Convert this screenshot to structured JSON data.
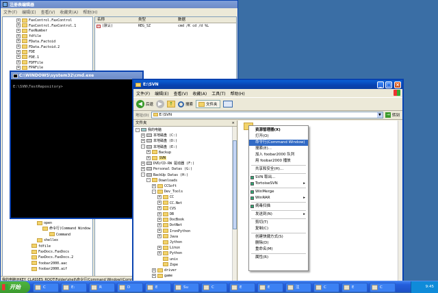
{
  "regedit": {
    "title": "注册表编辑器",
    "menu": [
      "文件(F)",
      "编辑(E)",
      "查看(V)",
      "收藏夹(A)",
      "帮助(H)"
    ],
    "tree_items": [
      "FaxControl.FaxControl",
      "FaxControl.FaxControl.1",
      "FaxNumber",
      "fdfile",
      "FData.Factoid",
      "FData.Factoid.2",
      "FDE",
      "FDE.1",
      "FDFFile",
      "FPAFile"
    ],
    "tree_bottom": [
      "open",
      "命令行(Command Window",
      "Command",
      "shellex",
      "fdfile",
      "FaxDocs.FaxDocs",
      "FaxDocs.FaxDocs.2",
      "foobar2000.aac",
      "foobar2000.aif"
    ],
    "columns": {
      "name": "名称",
      "type": "类型",
      "data": "数据"
    },
    "value_row": {
      "name": "(默认)",
      "type": "REG_SZ",
      "data": "cmd /K cd /d %L"
    },
    "status": "我的电脑\\HKEY_CLASSES_ROOT\\Folder\\shell\\命令行(Command Window)\\Command"
  },
  "cmd": {
    "title": "C:\\WINDOWS\\system32\\cmd.exe",
    "prompt": "E:\\SVN\\TestRepository>"
  },
  "explorer": {
    "title": "E:\\SVN",
    "menu": [
      "文件(F)",
      "编辑(E)",
      "查看(V)",
      "收藏(A)",
      "工具(T)",
      "帮助(H)"
    ],
    "toolbar": {
      "back": "后退",
      "search": "搜索",
      "folders": "文件夹"
    },
    "address_label": "地址(D)",
    "address_value": "E:\\SVN",
    "go_label": "转到",
    "folders_pane_title": "文件夹",
    "tree": [
      {
        "label": "我的电脑",
        "indent": 0,
        "sign": "-",
        "icon": "computer"
      },
      {
        "label": "本地磁盘 (C:)",
        "indent": 1,
        "sign": "+",
        "icon": "drive"
      },
      {
        "label": "本地磁盘 (D:)",
        "indent": 1,
        "sign": "+",
        "icon": "drive"
      },
      {
        "label": "本地磁盘 (E:)",
        "indent": 1,
        "sign": "-",
        "icon": "drive"
      },
      {
        "label": "Backup",
        "indent": 2,
        "sign": "+",
        "icon": "folder"
      },
      {
        "label": "SVN",
        "indent": 2,
        "sign": "+",
        "icon": "folder",
        "selected": true
      },
      {
        "label": "DVD/CD-RW 驱动器 (F:)",
        "indent": 1,
        "sign": "+",
        "icon": "drive"
      },
      {
        "label": "Personal Datas (G:)",
        "indent": 1,
        "sign": "+",
        "icon": "drive"
      },
      {
        "label": "BackUp Datas (H:)",
        "indent": 1,
        "sign": "-",
        "icon": "drive"
      },
      {
        "label": "Downloads",
        "indent": 2,
        "sign": "-",
        "icon": "folder"
      },
      {
        "label": "CCSoft",
        "indent": 3,
        "sign": "+",
        "icon": "folder"
      },
      {
        "label": "Dev_Tools",
        "indent": 3,
        "sign": "-",
        "icon": "folder"
      },
      {
        "label": "CC",
        "indent": 4,
        "sign": "+",
        "icon": "folder"
      },
      {
        "label": "CC.Net",
        "indent": 4,
        "sign": "+",
        "icon": "folder"
      },
      {
        "label": "CVS",
        "indent": 4,
        "sign": "+",
        "icon": "folder"
      },
      {
        "label": "DB",
        "indent": 4,
        "sign": "+",
        "icon": "folder"
      },
      {
        "label": "DocBook",
        "indent": 4,
        "sign": "+",
        "icon": "folder"
      },
      {
        "label": "DotNet",
        "indent": 4,
        "sign": "+",
        "icon": "folder"
      },
      {
        "label": "IronPython",
        "indent": 4,
        "sign": "+",
        "icon": "folder"
      },
      {
        "label": "Java",
        "indent": 4,
        "sign": "+",
        "icon": "folder"
      },
      {
        "label": "Jython",
        "indent": 4,
        "sign": "",
        "icon": "folder"
      },
      {
        "label": "Linux",
        "indent": 4,
        "sign": "+",
        "icon": "folder"
      },
      {
        "label": "Python",
        "indent": 4,
        "sign": "+",
        "icon": "folder"
      },
      {
        "label": "unix",
        "indent": 4,
        "sign": "",
        "icon": "folder"
      },
      {
        "label": "Zope",
        "indent": 4,
        "sign": "",
        "icon": "folder"
      },
      {
        "label": "driver",
        "indent": 3,
        "sign": "+",
        "icon": "folder"
      },
      {
        "label": "game",
        "indent": 3,
        "sign": "+",
        "icon": "folder"
      }
    ]
  },
  "context_menu": {
    "items": [
      {
        "label": "资源管理器(X)",
        "bold": true
      },
      {
        "label": "打开(O)"
      },
      {
        "label": "命令行(Command Window)",
        "highlighted": true
      },
      {
        "label": "搜索(E)..."
      },
      {
        "label": "加入 foobar2000 队列"
      },
      {
        "label": "用 foobar2000 播放"
      },
      {
        "sep": true
      },
      {
        "label": "共享和安全(H)..."
      },
      {
        "sep": true
      },
      {
        "label": "SVN 取出...",
        "icon": "svn-icon"
      },
      {
        "label": "TortoiseSVN",
        "submenu": true,
        "icon": "tortoise-icon"
      },
      {
        "sep": true
      },
      {
        "label": "WinMerge",
        "icon": "winmerge-icon"
      },
      {
        "label": "WinRAR",
        "submenu": true,
        "icon": "winrar-icon"
      },
      {
        "sep": true
      },
      {
        "label": "病毒扫描",
        "icon": "antivirus-icon"
      },
      {
        "sep": true
      },
      {
        "label": "发送到(N)",
        "submenu": true
      },
      {
        "sep": true
      },
      {
        "label": "剪切(T)"
      },
      {
        "label": "复制(C)"
      },
      {
        "sep": true
      },
      {
        "label": "创建快捷方式(S)"
      },
      {
        "label": "删除(D)"
      },
      {
        "label": "重命名(M)"
      },
      {
        "sep": true
      },
      {
        "label": "属性(R)"
      }
    ]
  },
  "taskbar": {
    "start_label": "开始",
    "tasks": [
      "C",
      "E:",
      "R",
      "D",
      "E",
      "Su",
      "C",
      "E",
      "E",
      "注",
      "C",
      "E",
      "C"
    ],
    "clock": "9:45"
  },
  "colors": {
    "desktop": "#3a6ea5",
    "xp_blue": "#0842b0",
    "highlight": "#316ac5",
    "taskbar": "#245edc",
    "start": "#3c9a2f"
  }
}
